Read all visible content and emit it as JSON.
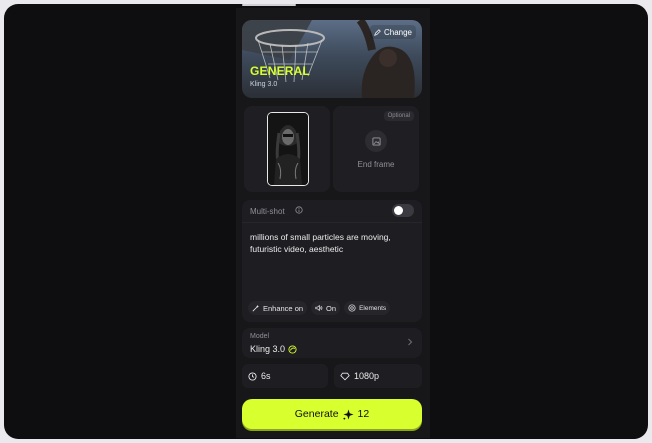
{
  "hero": {
    "change_label": "Change",
    "title": "GENERAL",
    "subtitle": "Kling 3.0"
  },
  "frames": {
    "optional_label": "Optional",
    "end_frame_label": "End frame"
  },
  "prompt": {
    "multishot_label": "Multi-shot",
    "multishot_enabled": false,
    "text": "millions of small particles are moving, futuristic video, aesthetic"
  },
  "chips": {
    "enhance": "Enhance on",
    "sound": "On",
    "elements": "Elements"
  },
  "model": {
    "label": "Model",
    "value": "Kling 3.0"
  },
  "options": {
    "duration": "6s",
    "resolution": "1080p"
  },
  "generate": {
    "label": "Generate",
    "cost": "12"
  },
  "colors": {
    "accent": "#d8ff2e",
    "background": "#0e0e10",
    "card": "#1e1e22"
  }
}
